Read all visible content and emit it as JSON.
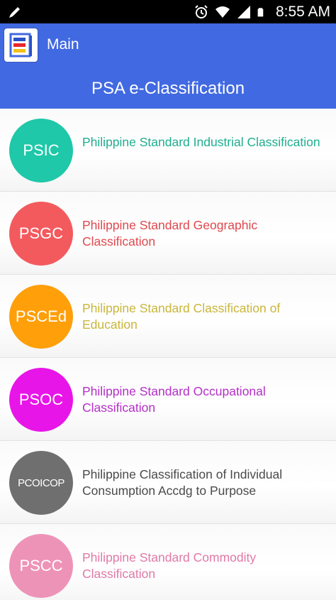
{
  "status_bar": {
    "time": "8:55 AM"
  },
  "app_bar": {
    "title": "Main"
  },
  "header": {
    "title": "PSA e-Classification"
  },
  "items": [
    {
      "code": "PSIC",
      "label": "Philippine Standard Industrial Classification",
      "circle_color": "#1ec8a8",
      "text_color": "#1fae8f"
    },
    {
      "code": "PSGC",
      "label": "Philippine Standard Geographic Classification",
      "circle_color": "#f35a5e",
      "text_color": "#e0484d"
    },
    {
      "code": "PSCEd",
      "label": "Philippine Standard Classification of Education",
      "circle_color": "#ff9f0a",
      "text_color": "#c9b63a"
    },
    {
      "code": "PSOC",
      "label": "Philippine Standard Occupational Classification",
      "circle_color": "#e815e8",
      "text_color": "#b42fc7"
    },
    {
      "code": "PCOICOP",
      "label": "Philippine Classification of Individual Consumption Accdg to Purpose",
      "circle_color": "#6f6f6f",
      "text_color": "#4a4a4a"
    },
    {
      "code": "PSCC",
      "label": "Philippine Standard Commodity Classification",
      "circle_color": "#ee93b8",
      "text_color": "#e07aa6"
    }
  ]
}
